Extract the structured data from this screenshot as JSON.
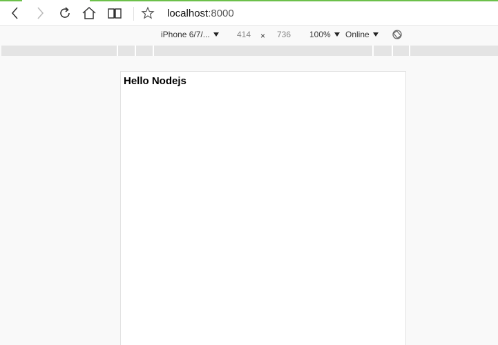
{
  "browser": {
    "address": {
      "host": "localhost",
      "port": ":8000"
    }
  },
  "device_toolbar": {
    "device": "iPhone 6/7/...",
    "width": "414",
    "times": "×",
    "height": "736",
    "zoom": "100%",
    "network": "Online"
  },
  "page": {
    "heading": "Hello Nodejs"
  },
  "colors": {
    "accent": "#6cc04a"
  }
}
